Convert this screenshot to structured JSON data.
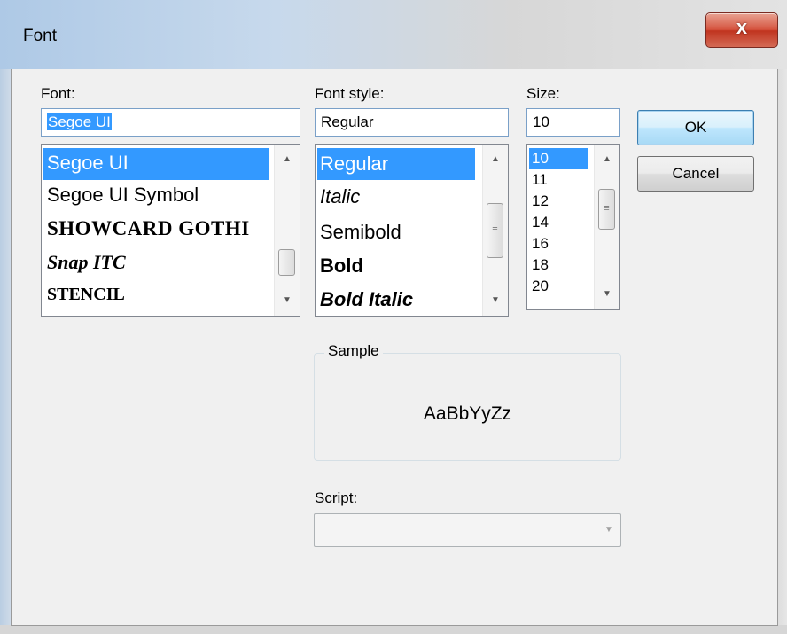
{
  "window": {
    "title": "Font",
    "close_glyph": "x"
  },
  "font": {
    "label": "Font:",
    "value": "Segoe UI",
    "items": [
      {
        "label": "Segoe UI",
        "selected": true
      },
      {
        "label": "Segoe UI Symbol",
        "selected": false
      },
      {
        "label": "SHOWCARD GOTHI",
        "selected": false
      },
      {
        "label": "Snap ITC",
        "selected": false
      },
      {
        "label": "STENCIL",
        "selected": false
      }
    ]
  },
  "style": {
    "label": "Font style:",
    "value": "Regular",
    "items": [
      {
        "label": "Regular",
        "selected": true
      },
      {
        "label": "Italic",
        "selected": false
      },
      {
        "label": "Semibold",
        "selected": false
      },
      {
        "label": "Bold",
        "selected": false
      },
      {
        "label": "Bold Italic",
        "selected": false
      }
    ]
  },
  "size": {
    "label": "Size:",
    "value": "10",
    "items": [
      {
        "label": "10",
        "selected": true
      },
      {
        "label": "11",
        "selected": false
      },
      {
        "label": "12",
        "selected": false
      },
      {
        "label": "14",
        "selected": false
      },
      {
        "label": "16",
        "selected": false
      },
      {
        "label": "18",
        "selected": false
      },
      {
        "label": "20",
        "selected": false
      }
    ]
  },
  "buttons": {
    "ok": "OK",
    "cancel": "Cancel"
  },
  "sample": {
    "label": "Sample",
    "text": "AaBbYyZz"
  },
  "script": {
    "label": "Script:",
    "value": ""
  },
  "icons": {
    "scroll_up": "scroll-up-arrow-icon",
    "scroll_down": "scroll-down-arrow-icon",
    "dropdown": "chevron-down-icon",
    "grip": "grip-icon"
  },
  "colors": {
    "selection": "#3399ff",
    "close_button": "#c7432f",
    "default_button": "#3c7fb1"
  }
}
